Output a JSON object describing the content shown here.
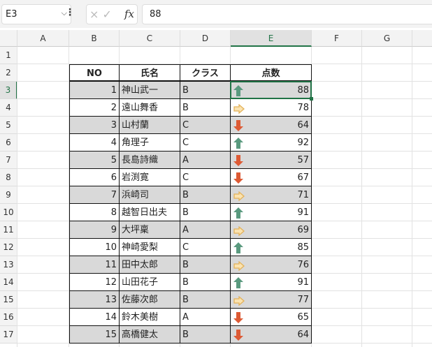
{
  "formula_bar": {
    "name_box": "E3",
    "formula": "88",
    "cancel_icon": "×",
    "enter_icon": "✓",
    "fx_label": "fx"
  },
  "columns": [
    "A",
    "B",
    "C",
    "D",
    "E",
    "F",
    "G"
  ],
  "selected_column": "E",
  "selected_row": 3,
  "row_numbers": [
    1,
    2,
    3,
    4,
    5,
    6,
    7,
    8,
    9,
    10,
    11,
    12,
    13,
    14,
    15,
    16,
    17
  ],
  "table": {
    "headers": [
      "NO",
      "氏名",
      "クラス",
      "点数"
    ],
    "rows": [
      {
        "no": "1",
        "name": "神山武一",
        "class": "B",
        "score": "88",
        "icon": "up"
      },
      {
        "no": "2",
        "name": "遠山舞香",
        "class": "B",
        "score": "78",
        "icon": "right"
      },
      {
        "no": "3",
        "name": "山村蘭",
        "class": "C",
        "score": "64",
        "icon": "down"
      },
      {
        "no": "4",
        "name": "角理子",
        "class": "C",
        "score": "92",
        "icon": "up"
      },
      {
        "no": "5",
        "name": "長島詩織",
        "class": "A",
        "score": "57",
        "icon": "down"
      },
      {
        "no": "6",
        "name": "岩渕寛",
        "class": "C",
        "score": "67",
        "icon": "down"
      },
      {
        "no": "7",
        "name": "浜崎司",
        "class": "B",
        "score": "71",
        "icon": "right"
      },
      {
        "no": "8",
        "name": "越智日出夫",
        "class": "B",
        "score": "91",
        "icon": "up"
      },
      {
        "no": "9",
        "name": "大坪稟",
        "class": "A",
        "score": "69",
        "icon": "right"
      },
      {
        "no": "10",
        "name": "神崎愛梨",
        "class": "C",
        "score": "85",
        "icon": "up"
      },
      {
        "no": "11",
        "name": "田中太郎",
        "class": "B",
        "score": "76",
        "icon": "right"
      },
      {
        "no": "12",
        "name": "山田花子",
        "class": "B",
        "score": "91",
        "icon": "up"
      },
      {
        "no": "13",
        "name": "佐藤次郎",
        "class": "B",
        "score": "77",
        "icon": "right"
      },
      {
        "no": "14",
        "name": "鈴木美樹",
        "class": "A",
        "score": "65",
        "icon": "down"
      },
      {
        "no": "15",
        "name": "高橋健太",
        "class": "B",
        "score": "64",
        "icon": "down"
      }
    ]
  },
  "colors": {
    "up": "#5a9a7f",
    "right": "#e3b25a",
    "down": "#dd5a34",
    "accent": "#217346",
    "shade": "#d9d9d9"
  }
}
